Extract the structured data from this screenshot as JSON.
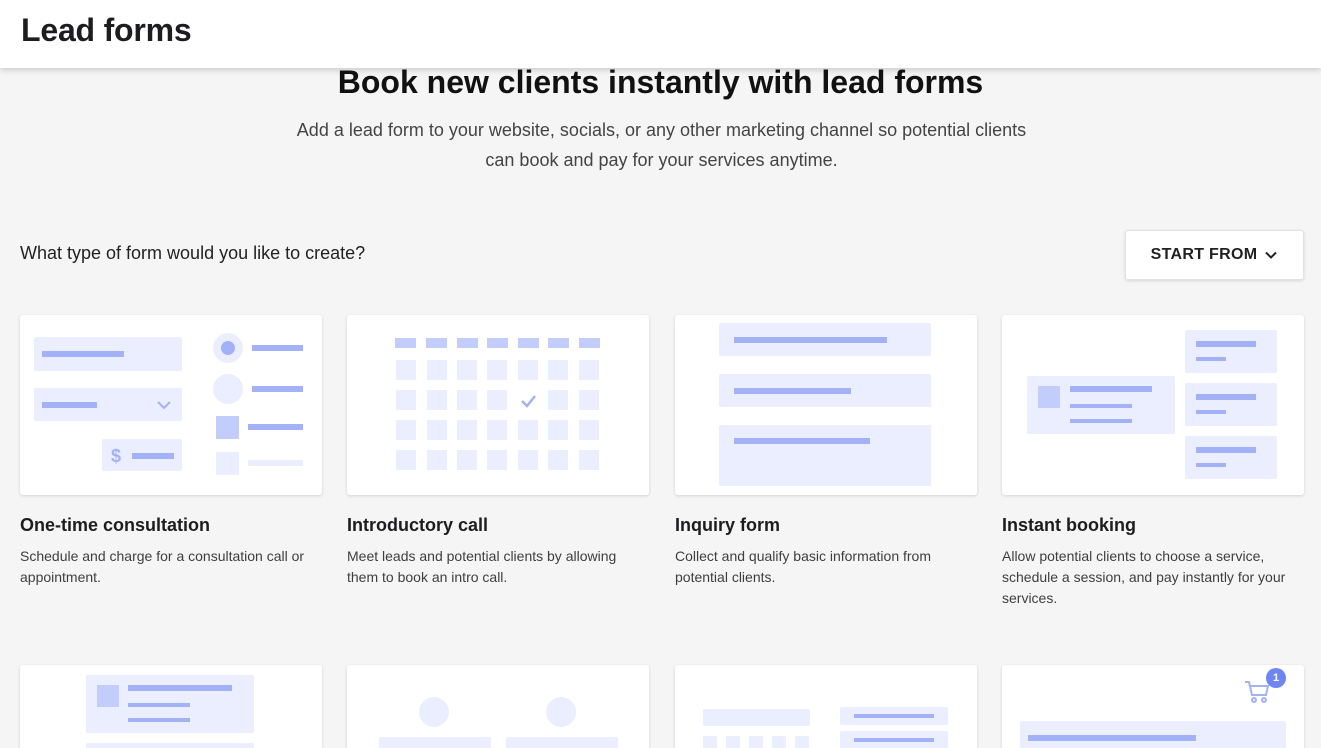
{
  "header": {
    "title": "Lead forms"
  },
  "hero": {
    "title": "Book new clients instantly with lead forms",
    "subtitle": "Add a lead form to your website, socials, or any other marketing channel so potential clients can book and pay for your services anytime."
  },
  "section": {
    "question": "What type of form would you like to create?",
    "start_from_label": "START FROM"
  },
  "cards": [
    {
      "title": "One-time consultation",
      "description": "Schedule and charge for a consultation call or appointment."
    },
    {
      "title": "Introductory call",
      "description": "Meet leads and potential clients by allowing them to book an intro call."
    },
    {
      "title": "Inquiry form",
      "description": "Collect and qualify basic information from potential clients."
    },
    {
      "title": "Instant booking",
      "description": "Allow potential clients to choose a service, schedule a session, and pay instantly for your services."
    }
  ],
  "cart_badge": "1",
  "colors": {
    "accent": "#a3b2f7",
    "accent_light": "#eaeefe",
    "badge": "#6f86f2"
  }
}
